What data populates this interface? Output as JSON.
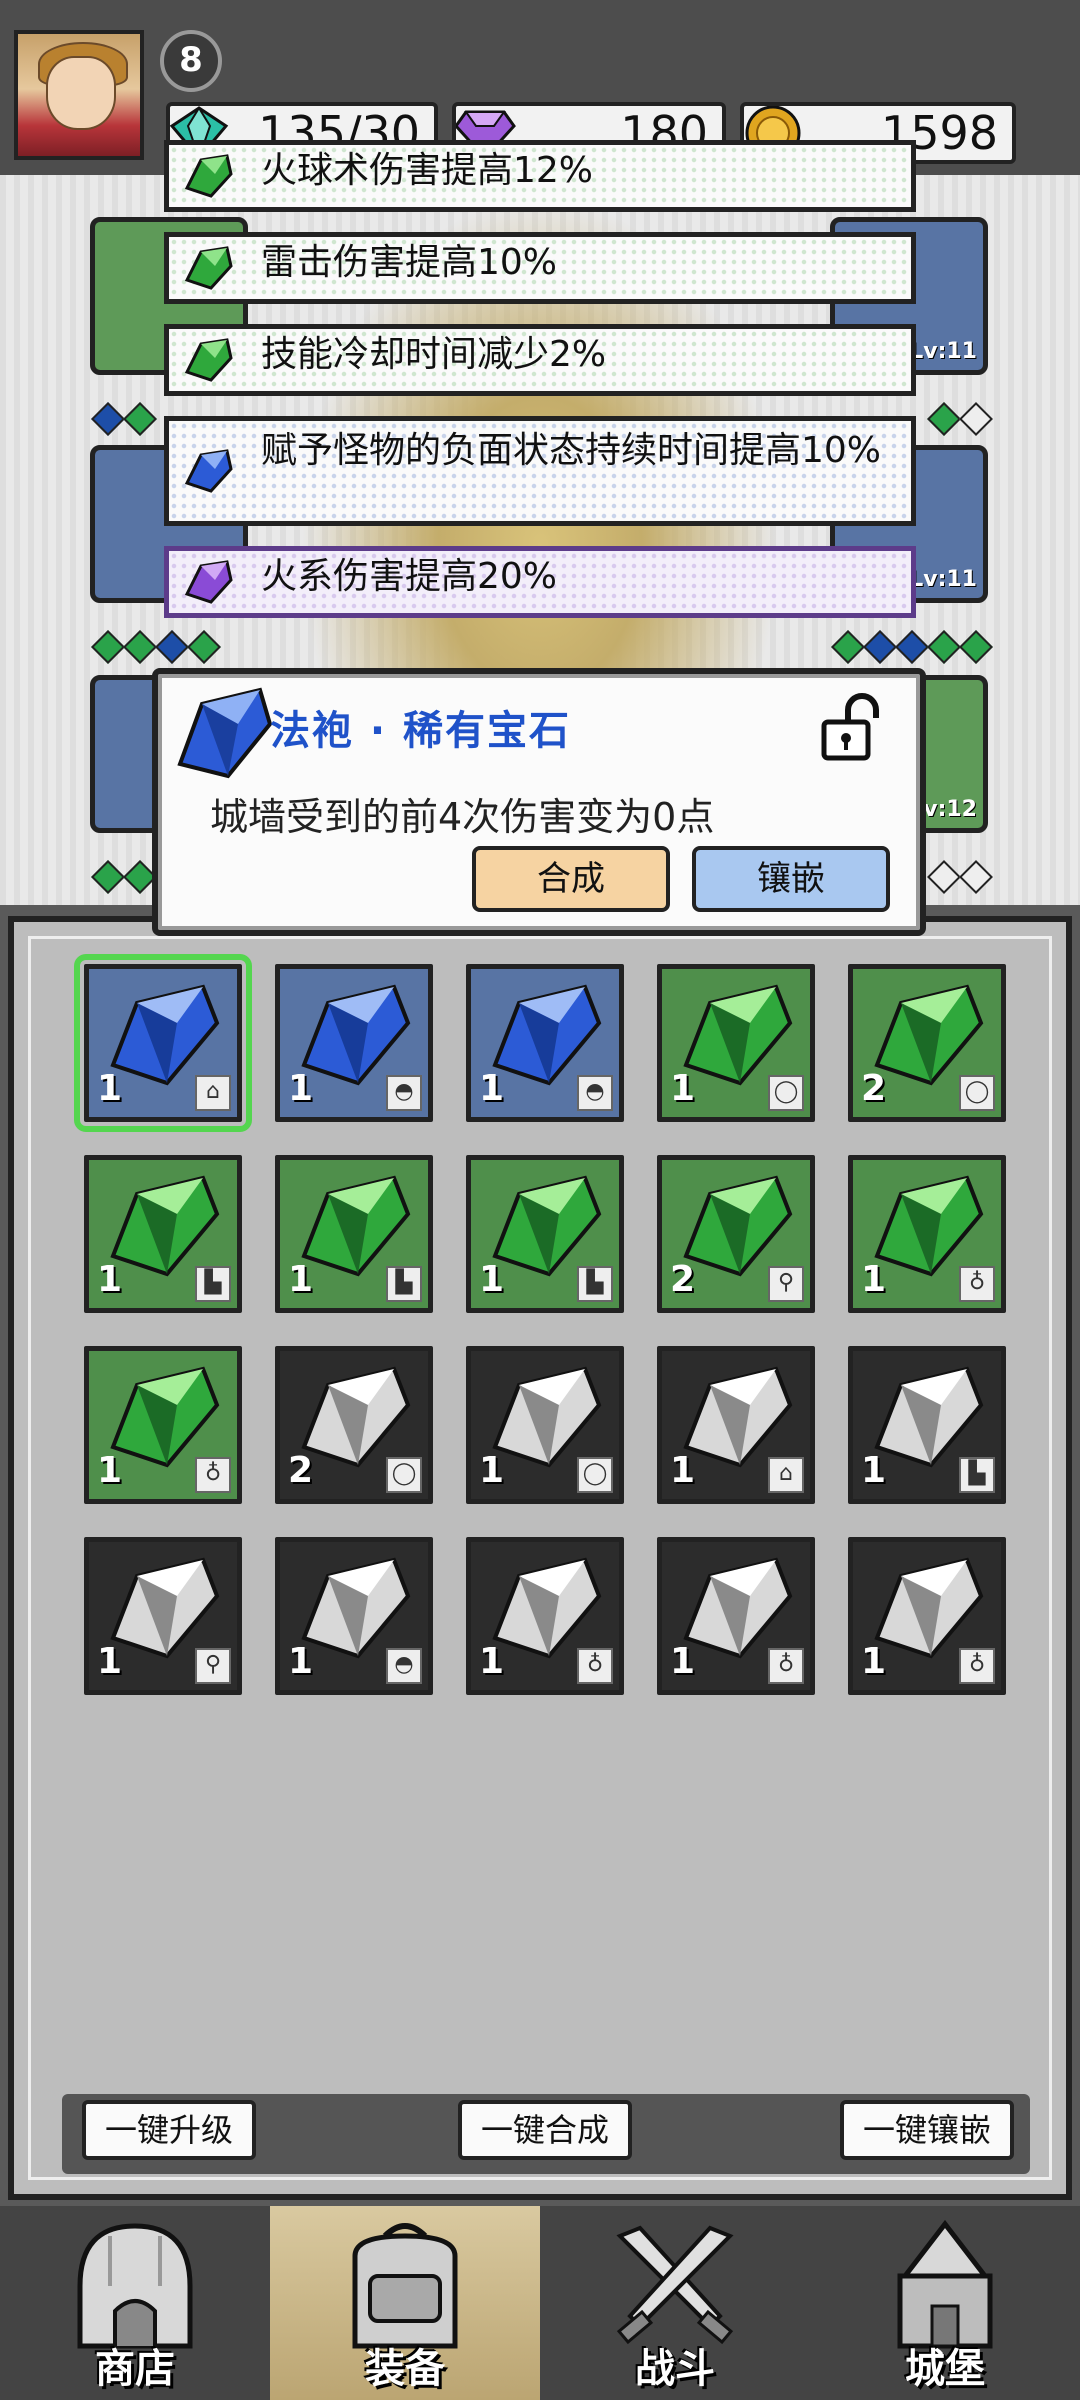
{
  "header": {
    "level": "8",
    "resources": [
      {
        "icon": "teal-gem-icon",
        "value": "135/30"
      },
      {
        "icon": "purple-gem-icon",
        "value": "180"
      },
      {
        "icon": "gold-coin-icon",
        "value": "1598"
      }
    ]
  },
  "equipment_slots": {
    "right_levels": [
      "Lv:11",
      "Lv:11",
      "Lv:12"
    ]
  },
  "bonuses": [
    {
      "icon": "green-gem-icon",
      "text": "火球术伤害提高12%"
    },
    {
      "icon": "green-gem-icon",
      "text": "雷击伤害提高10%"
    },
    {
      "icon": "green-gem-icon",
      "text": "技能冷却时间减少2%"
    },
    {
      "icon": "blue-gem-icon",
      "text": "赋予怪物的负面状态持续时间提高10%"
    },
    {
      "icon": "purple-gem-icon",
      "text": "火系伤害提高20%"
    }
  ],
  "popup": {
    "title": "法袍 · 稀有宝石",
    "description": "城墙受到的前4次伤害变为0点",
    "merge_label": "合成",
    "inlay_label": "镶嵌",
    "lock_icon": "unlock-icon"
  },
  "inventory": [
    {
      "color": "blue",
      "count": "1",
      "slot_icon": "robe-icon",
      "selected": true
    },
    {
      "color": "blue",
      "count": "1",
      "slot_icon": "hat-icon"
    },
    {
      "color": "blue",
      "count": "1",
      "slot_icon": "hat-icon"
    },
    {
      "color": "green",
      "count": "1",
      "slot_icon": "ring-icon"
    },
    {
      "color": "green",
      "count": "2",
      "slot_icon": "ring-icon"
    },
    {
      "color": "green",
      "count": "1",
      "slot_icon": "boots-icon"
    },
    {
      "color": "green",
      "count": "1",
      "slot_icon": "boots-icon"
    },
    {
      "color": "green",
      "count": "1",
      "slot_icon": "boots-icon"
    },
    {
      "color": "green",
      "count": "2",
      "slot_icon": "staff-icon"
    },
    {
      "color": "green",
      "count": "1",
      "slot_icon": "necklace-icon"
    },
    {
      "color": "green",
      "count": "1",
      "slot_icon": "necklace-icon"
    },
    {
      "color": "gray",
      "count": "2",
      "slot_icon": "ring-icon"
    },
    {
      "color": "gray",
      "count": "1",
      "slot_icon": "ring-icon"
    },
    {
      "color": "gray",
      "count": "1",
      "slot_icon": "robe-icon"
    },
    {
      "color": "gray",
      "count": "1",
      "slot_icon": "boots-icon"
    },
    {
      "color": "gray",
      "count": "1",
      "slot_icon": "staff-icon"
    },
    {
      "color": "gray",
      "count": "1",
      "slot_icon": "hat-icon"
    },
    {
      "color": "gray",
      "count": "1",
      "slot_icon": "necklace-icon"
    },
    {
      "color": "gray",
      "count": "1",
      "slot_icon": "necklace-icon"
    },
    {
      "color": "gray",
      "count": "1",
      "slot_icon": "necklace-icon"
    }
  ],
  "actions": {
    "upgrade_all": "一键升级",
    "merge_all": "一键合成",
    "inlay_all": "一键镶嵌"
  },
  "nav": [
    {
      "label": "商店",
      "icon": "shop-icon"
    },
    {
      "label": "装备",
      "icon": "backpack-icon",
      "active": true
    },
    {
      "label": "战斗",
      "icon": "crossed-swords-icon"
    },
    {
      "label": "城堡",
      "icon": "castle-icon"
    }
  ],
  "colors": {
    "gem_blue": "#2c5bd6",
    "gem_green": "#2fa83c",
    "gem_gray": "#d8d8d8",
    "gem_purple": "#8a4bd6",
    "title_blue": "#1f52c9"
  }
}
